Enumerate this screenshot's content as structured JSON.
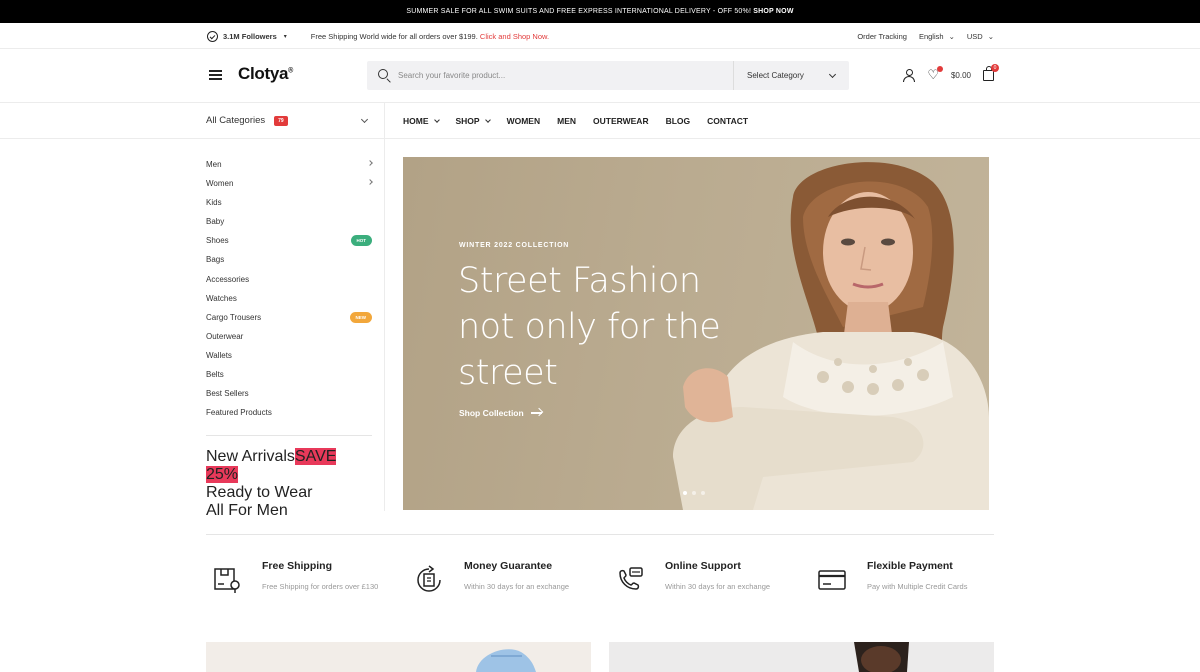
{
  "announcement": {
    "text": "SUMMER SALE FOR ALL SWIM SUITS AND FREE EXPRESS INTERNATIONAL DELIVERY - OFF 50%!",
    "link": "SHOP NOW"
  },
  "topbar": {
    "followers": "3.1M Followers",
    "shipping_text": "Free Shipping World wide for all orders over $199.",
    "shipping_link": "Click and Shop Now.",
    "order_tracking": "Order Tracking",
    "language": "English",
    "currency": "USD"
  },
  "header": {
    "logo": "Clotya",
    "logo_mark": "®",
    "search_placeholder": "Search your favorite product...",
    "category_select": "Select Category",
    "cart_total": "$0.00",
    "cart_count": "0"
  },
  "nav": {
    "all_categories": "All Categories",
    "all_categories_badge": "79",
    "items": [
      "HOME",
      "SHOP",
      "WOMEN",
      "MEN",
      "OUTERWEAR",
      "BLOG",
      "CONTACT"
    ]
  },
  "sidebar": {
    "categories": [
      {
        "label": "Men",
        "arrow": true
      },
      {
        "label": "Women",
        "arrow": true
      },
      {
        "label": "Kids"
      },
      {
        "label": "Baby"
      },
      {
        "label": "Shoes",
        "tag": "HOT",
        "tag_color": "#3bae7d"
      },
      {
        "label": "Bags"
      },
      {
        "label": "Accessories"
      },
      {
        "label": "Watches"
      },
      {
        "label": "Cargo Trousers",
        "tag": "NEW",
        "tag_color": "#f2a73b"
      },
      {
        "label": "Outerwear"
      },
      {
        "label": "Wallets"
      },
      {
        "label": "Belts"
      },
      {
        "label": "Best Sellers"
      },
      {
        "label": "Featured Products"
      }
    ],
    "extra": [
      {
        "label": "New Arrivals",
        "tag": "SAVE 25%",
        "tag_color": "#e8395a"
      },
      {
        "label": "Ready to Wear"
      },
      {
        "label": "All For Men"
      }
    ]
  },
  "hero": {
    "eyebrow": "WINTER 2022 COLLECTION",
    "title": "Street Fashion not only for the street",
    "cta": "Shop Collection",
    "slides": 3,
    "active_slide": 1
  },
  "features": [
    {
      "title": "Free Shipping",
      "desc": "Free Shipping for orders over £130",
      "icon": "box-location-icon"
    },
    {
      "title": "Money Guarantee",
      "desc": "Within 30 days for an exchange",
      "icon": "money-return-icon"
    },
    {
      "title": "Online Support",
      "desc": "Within 30 days for an exchange",
      "icon": "phone-support-icon"
    },
    {
      "title": "Flexible Payment",
      "desc": "Pay with Multiple Credit Cards",
      "icon": "credit-card-icon"
    }
  ],
  "colors": {
    "accent": "#e23b3b",
    "hero_bg": "#b8a98f",
    "announcement_bg": "#000000"
  }
}
